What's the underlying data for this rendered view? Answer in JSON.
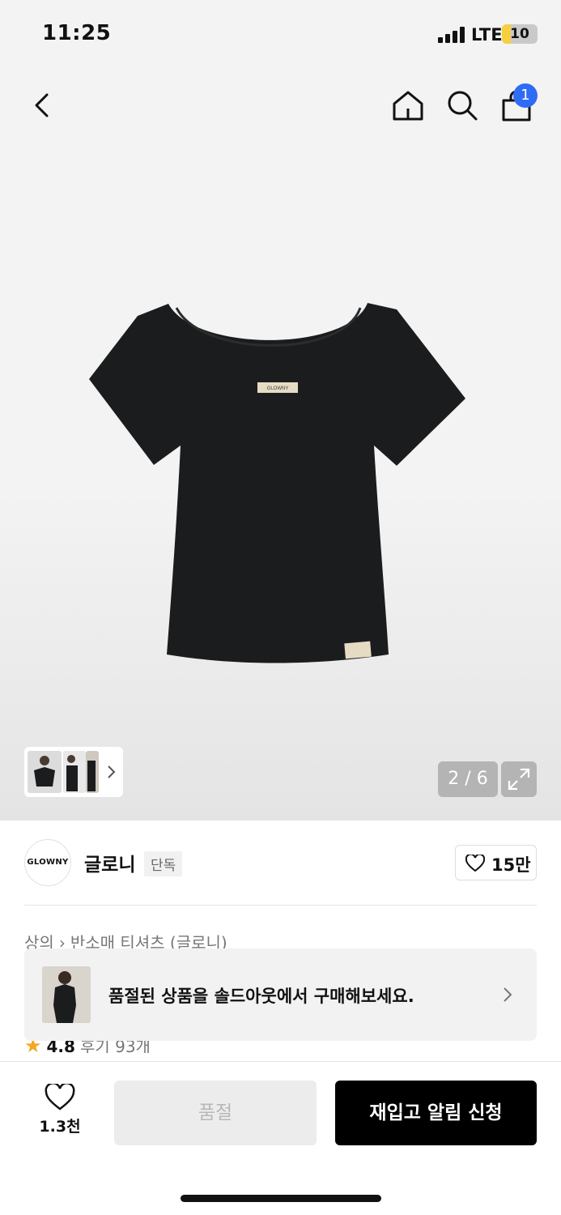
{
  "status_bar": {
    "time": "11:25",
    "network": "LTE",
    "battery": "10",
    "battery_level": 0.1
  },
  "nav": {
    "cart_count": "1"
  },
  "gallery": {
    "page_indicator": "2 / 6",
    "label_text": "GLOWNY"
  },
  "brand": {
    "logo_text": "GLOWNY",
    "name": "글로니",
    "tag": "단독",
    "likes": "15만"
  },
  "breadcrumb": {
    "category": "상의",
    "subcategory": "반소매 티셔츠 (글로니)"
  },
  "rating": {
    "score": "4.8",
    "reviews": "후기 93개"
  },
  "soldout_banner": {
    "text": "품절된 상품을 솔드아웃에서 구매해보세요."
  },
  "bottom_bar": {
    "wish_count": "1.3천",
    "soldout_label": "품절",
    "restock_label": "재입고 알림 신청"
  },
  "colors": {
    "badge": "#2f6cf5",
    "star": "#f5a623",
    "primary_button": "#000000",
    "disabled_button": "#ececec"
  }
}
